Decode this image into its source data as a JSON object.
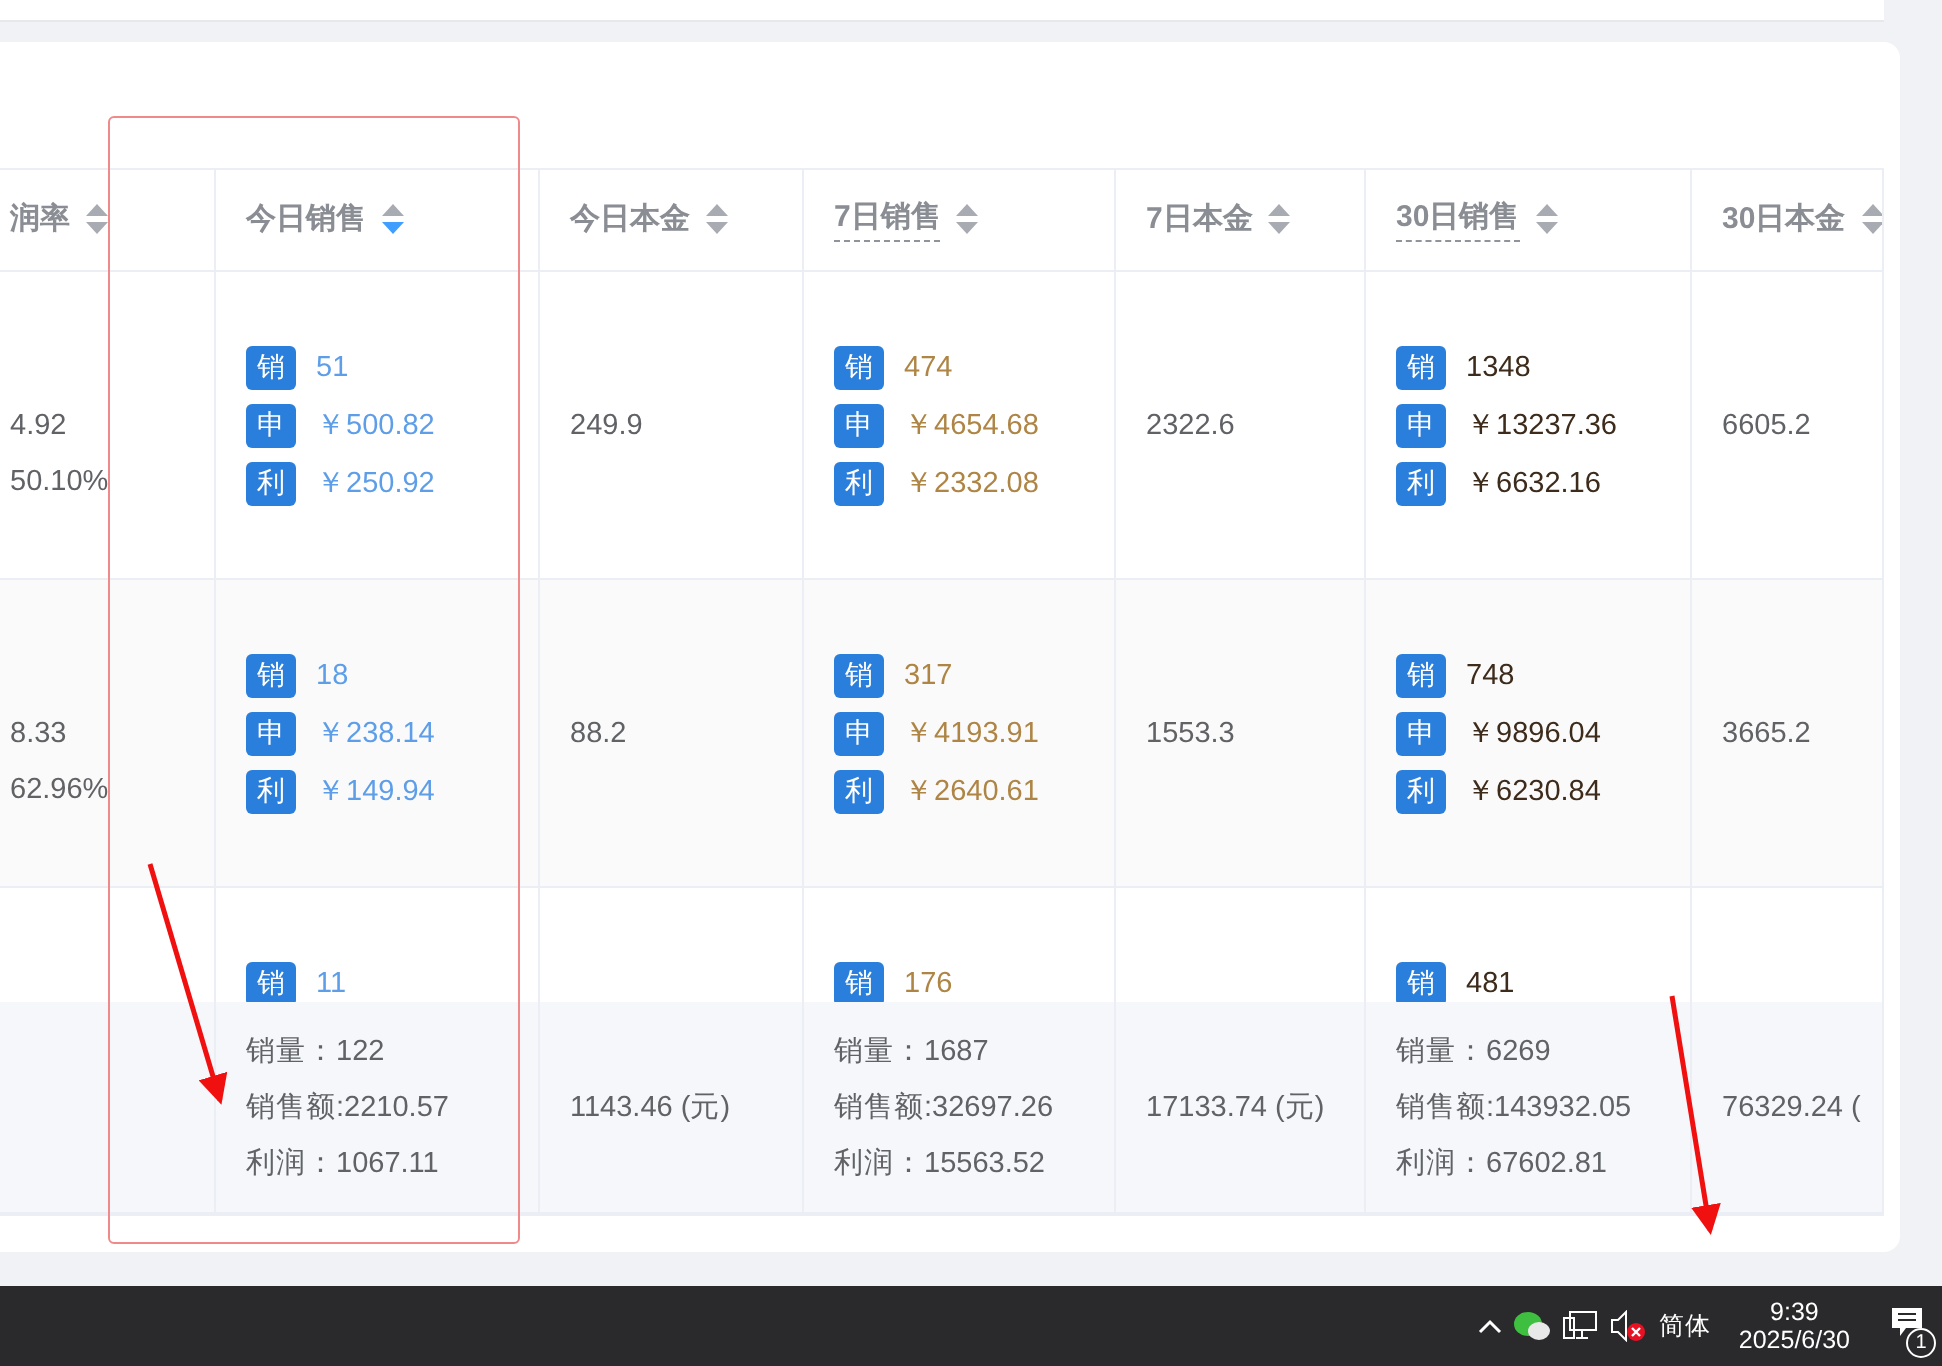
{
  "table": {
    "columns": [
      {
        "label": "润率",
        "sorted": false,
        "hint": false
      },
      {
        "label": "今日销售",
        "sorted": true,
        "hint": false
      },
      {
        "label": "今日本金",
        "sorted": false,
        "hint": false
      },
      {
        "label": "7日销售",
        "sorted": false,
        "hint": true
      },
      {
        "label": "7日本金",
        "sorted": false,
        "hint": false
      },
      {
        "label": "30日销售",
        "sorted": false,
        "hint": true
      },
      {
        "label": "30日本金",
        "sorted": false,
        "hint": false
      }
    ],
    "rows": [
      {
        "cells": [
          {
            "kind": "text",
            "lines": [
              "4.92",
              "50.10%"
            ]
          },
          {
            "kind": "sales",
            "color": "#5e9ee8",
            "lines": [
              {
                "tag": "销",
                "value": "51"
              },
              {
                "tag": "申",
                "value": "￥500.82"
              },
              {
                "tag": "利",
                "value": "￥250.92"
              }
            ]
          },
          {
            "kind": "text",
            "lines": [
              "249.9"
            ]
          },
          {
            "kind": "sales",
            "color": "#ae8545",
            "lines": [
              {
                "tag": "销",
                "value": "474"
              },
              {
                "tag": "申",
                "value": "￥4654.68"
              },
              {
                "tag": "利",
                "value": "￥2332.08"
              }
            ]
          },
          {
            "kind": "text",
            "lines": [
              "2322.6"
            ]
          },
          {
            "kind": "sales",
            "color": "#3d2b1c",
            "lines": [
              {
                "tag": "销",
                "value": "1348"
              },
              {
                "tag": "申",
                "value": "￥13237.36"
              },
              {
                "tag": "利",
                "value": "￥6632.16"
              }
            ]
          },
          {
            "kind": "text",
            "lines": [
              "6605.2"
            ]
          }
        ]
      },
      {
        "cells": [
          {
            "kind": "text",
            "lines": [
              "8.33",
              "62.96%"
            ]
          },
          {
            "kind": "sales",
            "color": "#5e9ee8",
            "lines": [
              {
                "tag": "销",
                "value": "18"
              },
              {
                "tag": "申",
                "value": "￥238.14"
              },
              {
                "tag": "利",
                "value": "￥149.94"
              }
            ]
          },
          {
            "kind": "text",
            "lines": [
              "88.2"
            ]
          },
          {
            "kind": "sales",
            "color": "#ae8545",
            "lines": [
              {
                "tag": "销",
                "value": "317"
              },
              {
                "tag": "申",
                "value": "￥4193.91"
              },
              {
                "tag": "利",
                "value": "￥2640.61"
              }
            ]
          },
          {
            "kind": "text",
            "lines": [
              "1553.3"
            ]
          },
          {
            "kind": "sales",
            "color": "#3d2b1c",
            "lines": [
              {
                "tag": "销",
                "value": "748"
              },
              {
                "tag": "申",
                "value": "￥9896.04"
              },
              {
                "tag": "利",
                "value": "￥6230.84"
              }
            ]
          },
          {
            "kind": "text",
            "lines": [
              "3665.2"
            ]
          }
        ]
      },
      {
        "cells": [
          {
            "kind": "blank"
          },
          {
            "kind": "sales",
            "color": "#5e9ee8",
            "lines": [
              {
                "tag": "销",
                "value": "11"
              }
            ]
          },
          {
            "kind": "blank"
          },
          {
            "kind": "sales",
            "color": "#ae8545",
            "lines": [
              {
                "tag": "销",
                "value": "176"
              }
            ]
          },
          {
            "kind": "blank"
          },
          {
            "kind": "sales",
            "color": "#3d2b1c",
            "lines": [
              {
                "tag": "销",
                "value": "481"
              }
            ]
          },
          {
            "kind": "blank"
          }
        ]
      }
    ],
    "summary": [
      {
        "kind": "blank"
      },
      {
        "kind": "text",
        "lines": [
          "销量：122",
          "销售额:2210.57",
          "利润：1067.11"
        ]
      },
      {
        "kind": "text",
        "lines": [
          "1143.46 (元)"
        ]
      },
      {
        "kind": "text",
        "lines": [
          "销量：1687",
          "销售额:32697.26",
          "利润：15563.52"
        ]
      },
      {
        "kind": "text",
        "lines": [
          "17133.74 (元)"
        ]
      },
      {
        "kind": "text",
        "lines": [
          "销量：6269",
          "销售额:143932.05",
          "利润：67602.81"
        ]
      },
      {
        "kind": "text",
        "lines": [
          "76329.24 ("
        ]
      }
    ]
  },
  "taskbar": {
    "ime": "简体",
    "time": "9:39",
    "date": "2025/6/30",
    "notifications": "1"
  }
}
